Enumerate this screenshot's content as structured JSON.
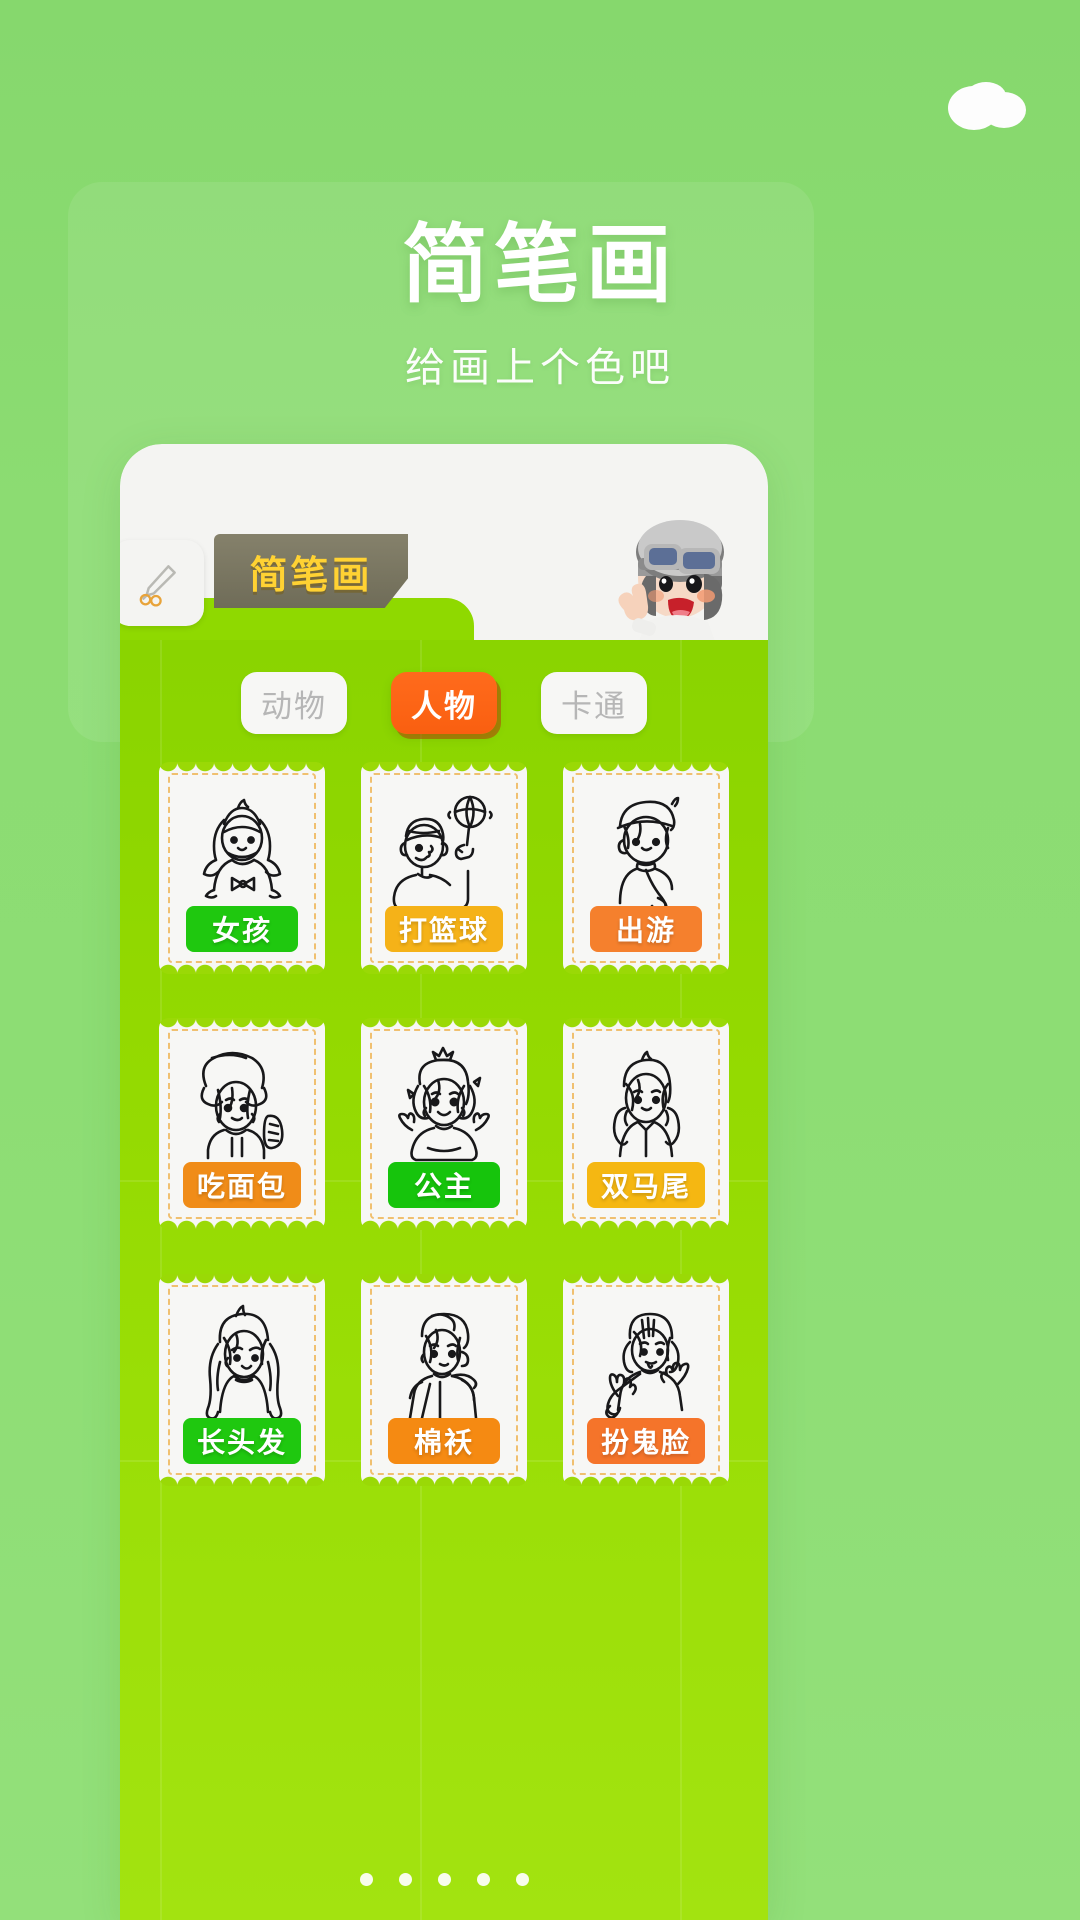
{
  "header": {
    "title": "简笔画",
    "subtitle": "给画上个色吧"
  },
  "app": {
    "ribbon_label": "简笔画",
    "brush_icon": "paint-brush-icon",
    "mascot": "pilot-kid-mascot"
  },
  "tabs": [
    {
      "label": "动物",
      "active": false
    },
    {
      "label": "人物",
      "active": true
    },
    {
      "label": "卡通",
      "active": false
    }
  ],
  "cards": [
    {
      "label": "女孩",
      "color": "#1fc80f",
      "art": "girl-bowtie"
    },
    {
      "label": "打篮球",
      "color": "#f5b218",
      "art": "boy-basketball"
    },
    {
      "label": "出游",
      "color": "#f5802d",
      "art": "girl-beret-scarf"
    },
    {
      "label": "吃面包",
      "color": "#f08c18",
      "art": "girl-eating-bread"
    },
    {
      "label": "公主",
      "color": "#16c40c",
      "art": "princess-crown"
    },
    {
      "label": "双马尾",
      "color": "#f5b712",
      "art": "girl-twintails"
    },
    {
      "label": "长头发",
      "color": "#1fc80f",
      "art": "girl-long-hair"
    },
    {
      "label": "棉袄",
      "color": "#f58a12",
      "art": "girl-padded-coat"
    },
    {
      "label": "扮鬼脸",
      "color": "#f5742a",
      "art": "girl-funny-face"
    }
  ],
  "pagination": {
    "dots": 5,
    "active_index": 0
  },
  "colors": {
    "page_bg_top": "#86d86d",
    "app_body_green": "#93d900",
    "tab_active": "#fa5f10",
    "ribbon_bg": "#6f6c58",
    "ribbon_text": "#ffd233"
  }
}
